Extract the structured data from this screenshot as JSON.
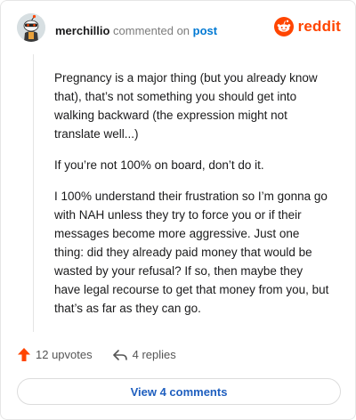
{
  "comment": {
    "username": "merchillio",
    "action_text": "commented on",
    "link_text": "post"
  },
  "brand": {
    "name": "reddit",
    "color": "#ff4500",
    "icon": "reddit-snoo-icon"
  },
  "body": {
    "paragraphs": [
      "Pregnancy is a major thing (but you already know that), that’s not something you should get into walking backward (the expression might not translate well...)",
      "If you’re not 100% on board, don’t do it.",
      "I 100% understand their frustration so I’m gonna go with NAH unless they try to force you or if their messages become more aggressive. Just one thing: did they already paid money that would be wasted by your refusal? If so, then maybe they have legal recourse to get that money from you, but that’s as far as they can go."
    ]
  },
  "actions": {
    "upvotes_label": "12 upvotes",
    "upvote_icon": "upvote-arrow-icon",
    "replies_label": "4 replies",
    "reply_icon": "reply-arrow-icon"
  },
  "footer": {
    "view_label": "View 4 comments"
  },
  "colors": {
    "accent": "#ff4500",
    "link": "#0079d3",
    "button_text": "#1f5fbf"
  }
}
